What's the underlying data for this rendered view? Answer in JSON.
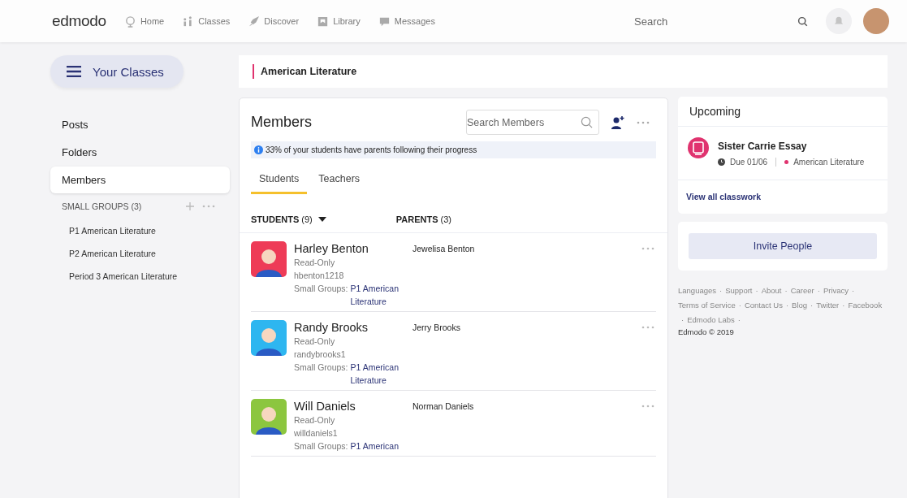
{
  "nav": {
    "logo": "edmodo",
    "items": [
      {
        "label": "Home"
      },
      {
        "label": "Classes"
      },
      {
        "label": "Discover"
      },
      {
        "label": "Library"
      },
      {
        "label": "Messages"
      }
    ],
    "search": {
      "placeholder": "Search"
    }
  },
  "sidebar": {
    "classes_button": "Your Classes",
    "items": [
      {
        "label": "Posts",
        "selected": false
      },
      {
        "label": "Folders",
        "selected": false
      },
      {
        "label": "Members",
        "selected": true
      }
    ],
    "small_groups": {
      "title": "SMALL GROUPS (3)",
      "items": [
        "P1 American Literature",
        "P2 American Literature",
        "Period 3 American Literature"
      ]
    }
  },
  "class_title": "American Literature",
  "members": {
    "title": "Members",
    "search": {
      "placeholder": "Search Members"
    },
    "notice": "33% of your students have parents following their progress",
    "tabs": [
      {
        "label": "Students",
        "selected": true
      },
      {
        "label": "Teachers",
        "selected": false
      }
    ],
    "columns": [
      {
        "label": "STUDENTS",
        "count": "(9)"
      },
      {
        "label": "PARENTS",
        "count": "(3)"
      }
    ],
    "rows": [
      {
        "name": "Harley Benton",
        "role": "Read-Only",
        "username": "hbenton1218",
        "groups_label": "Small Groups:",
        "group": "P1 American Literature",
        "parent": "Jewelisa Benton",
        "color": "#ee3b57"
      },
      {
        "name": "Randy Brooks",
        "role": "Read-Only",
        "username": "randybrooks1",
        "groups_label": "Small Groups:",
        "group": "P1 American Literature",
        "parent": "Jerry Brooks",
        "color": "#2eb6f0"
      },
      {
        "name": "Will Daniels",
        "role": "Read-Only",
        "username": "willdaniels1",
        "groups_label": "Small Groups:",
        "group": "P1 American",
        "parent": "Norman Daniels",
        "color": "#8cc63f"
      }
    ]
  },
  "upcoming": {
    "title": "Upcoming",
    "items": [
      {
        "title": "Sister Carrie Essay",
        "due": "Due 01/06",
        "class": "American Literature",
        "color": "#e0336f"
      }
    ],
    "link": "View all classwork"
  },
  "invite_button": "Invite People",
  "footer": {
    "separator": "·",
    "links": [
      "Languages",
      "Support",
      "About",
      "Career",
      "Privacy",
      "Terms of Service",
      "Contact Us",
      "Blog",
      "Twitter",
      "Facebook",
      "Edmodo Labs"
    ],
    "copyright": "Edmodo © 2019"
  }
}
